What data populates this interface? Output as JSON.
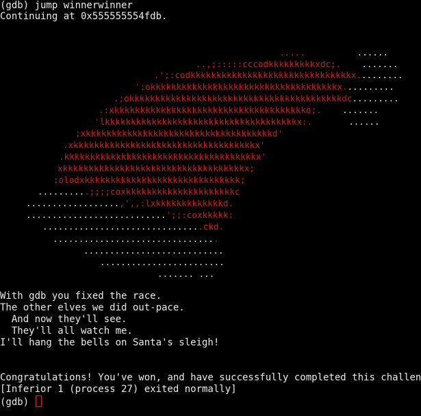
{
  "colors": {
    "background": "#000000",
    "text": "#eaeaea",
    "art_red": "#d11b1b",
    "art_white": "#e4e4e4",
    "cursor": "#e0191b"
  },
  "header": {
    "command_line": "(gdb) jump winnerwinner",
    "continuing_line": "Continuing at 0x555555554fdb."
  },
  "ascii_art": [
    {
      "red": "",
      "white": "",
      "red2": ".....",
      "white2": "          ......"
    },
    {
      "red": "..,;:::::cccodkkkkkkkkkxdc;.",
      "white": "    .......",
      "red2": "",
      "white2": ""
    },
    {
      "red": ".';:codkkkkkkkkkkkkkkkkkkkkkkkkkkkkkkkx.",
      "white": "........",
      "red2": "",
      "white2": ""
    },
    {
      "red": "':okkkkkkkkkkkkkkkkkkkkkkkkkkkkkkkkkkkkx.",
      "white": ".........",
      "red2": "",
      "white2": ""
    },
    {
      "red": ".;okkkkkkkkkkkkkkkkkkkkkkkkkkkkkkkkkkkkkkkkkdc",
      "white": ".........",
      "red2": "",
      "white2": ""
    },
    {
      "red": ".:xkkkkkkkkkkkkkkkkkkkkkkkkkkkkkkkkkkkkko;.",
      "white": "    .......",
      "red2": "",
      "white2": ""
    },
    {
      "red": "'lkkkkkkkkkkkkkkkkkkkkkkkkkkkkkkkkkkkkkx:.",
      "white": "       ......",
      "red2": "",
      "white2": ""
    },
    {
      "red": ";xkkkkkkkkkkkkkkkkkkkkkkkkkkkkkkkkkkkkd'",
      "white": "",
      "red2": "",
      "white2": ""
    },
    {
      "red": ".xkkkkkkkkkkkkkkkkkkkkkkkkkkkkkkkkkkkx'",
      "white": "",
      "red2": "",
      "white2": ""
    },
    {
      "red": ".kkkkkkkkkkkkkkkkkkkkkkkkkkkkkkkkkkkkkx'",
      "white": "",
      "red2": "",
      "white2": ""
    },
    {
      "red": "xkkkkkkkkkkkkkkkkkkkkkkkkkkkkkkkkkkkx;",
      "white": "",
      "red2": "",
      "white2": ""
    },
    {
      "red": ":olodxkkkkkkkkkkkkkkkkkkkkkkkkkkkkkk;",
      "white": "",
      "red2": "",
      "white2": ""
    },
    {
      "red": "",
      "white": ".........",
      "red2": ".;;;;coxkkkkkkkkkkkkkkkkkkkkkc",
      "white2": ""
    },
    {
      "red": "",
      "white": "..................",
      "red2": ",',,:lxkkkkkkkkkkkkkd.",
      "white2": ""
    },
    {
      "red": "",
      "white": "...........................",
      "red2": "';;:coxkkkkk:",
      "white2": ""
    },
    {
      "red": "",
      "white": "..............................",
      "red2": ".ckd.",
      "white2": ""
    },
    {
      "red": "",
      "white": "...............................",
      "red2": ".",
      "white2": ""
    },
    {
      "red": "",
      "white": "...........................",
      "red2": "",
      "white2": ""
    },
    {
      "red": "",
      "white": "........................",
      "red2": "",
      "white2": ""
    },
    {
      "red": "",
      "white": "....... ...",
      "red2": "",
      "white2": ""
    }
  ],
  "poem": [
    "With gdb you fixed the race.",
    "The other elves we did out-pace.",
    "  And now they'll see.",
    "  They'll all watch me.",
    "I'll hang the bells on Santa's sleigh!"
  ],
  "footer": {
    "congrats_line": "Congratulations! You've won, and have successfully completed this challenge.",
    "exit_line": "[Inferior 1 (process 27) exited normally]",
    "prompt": "(gdb) "
  }
}
